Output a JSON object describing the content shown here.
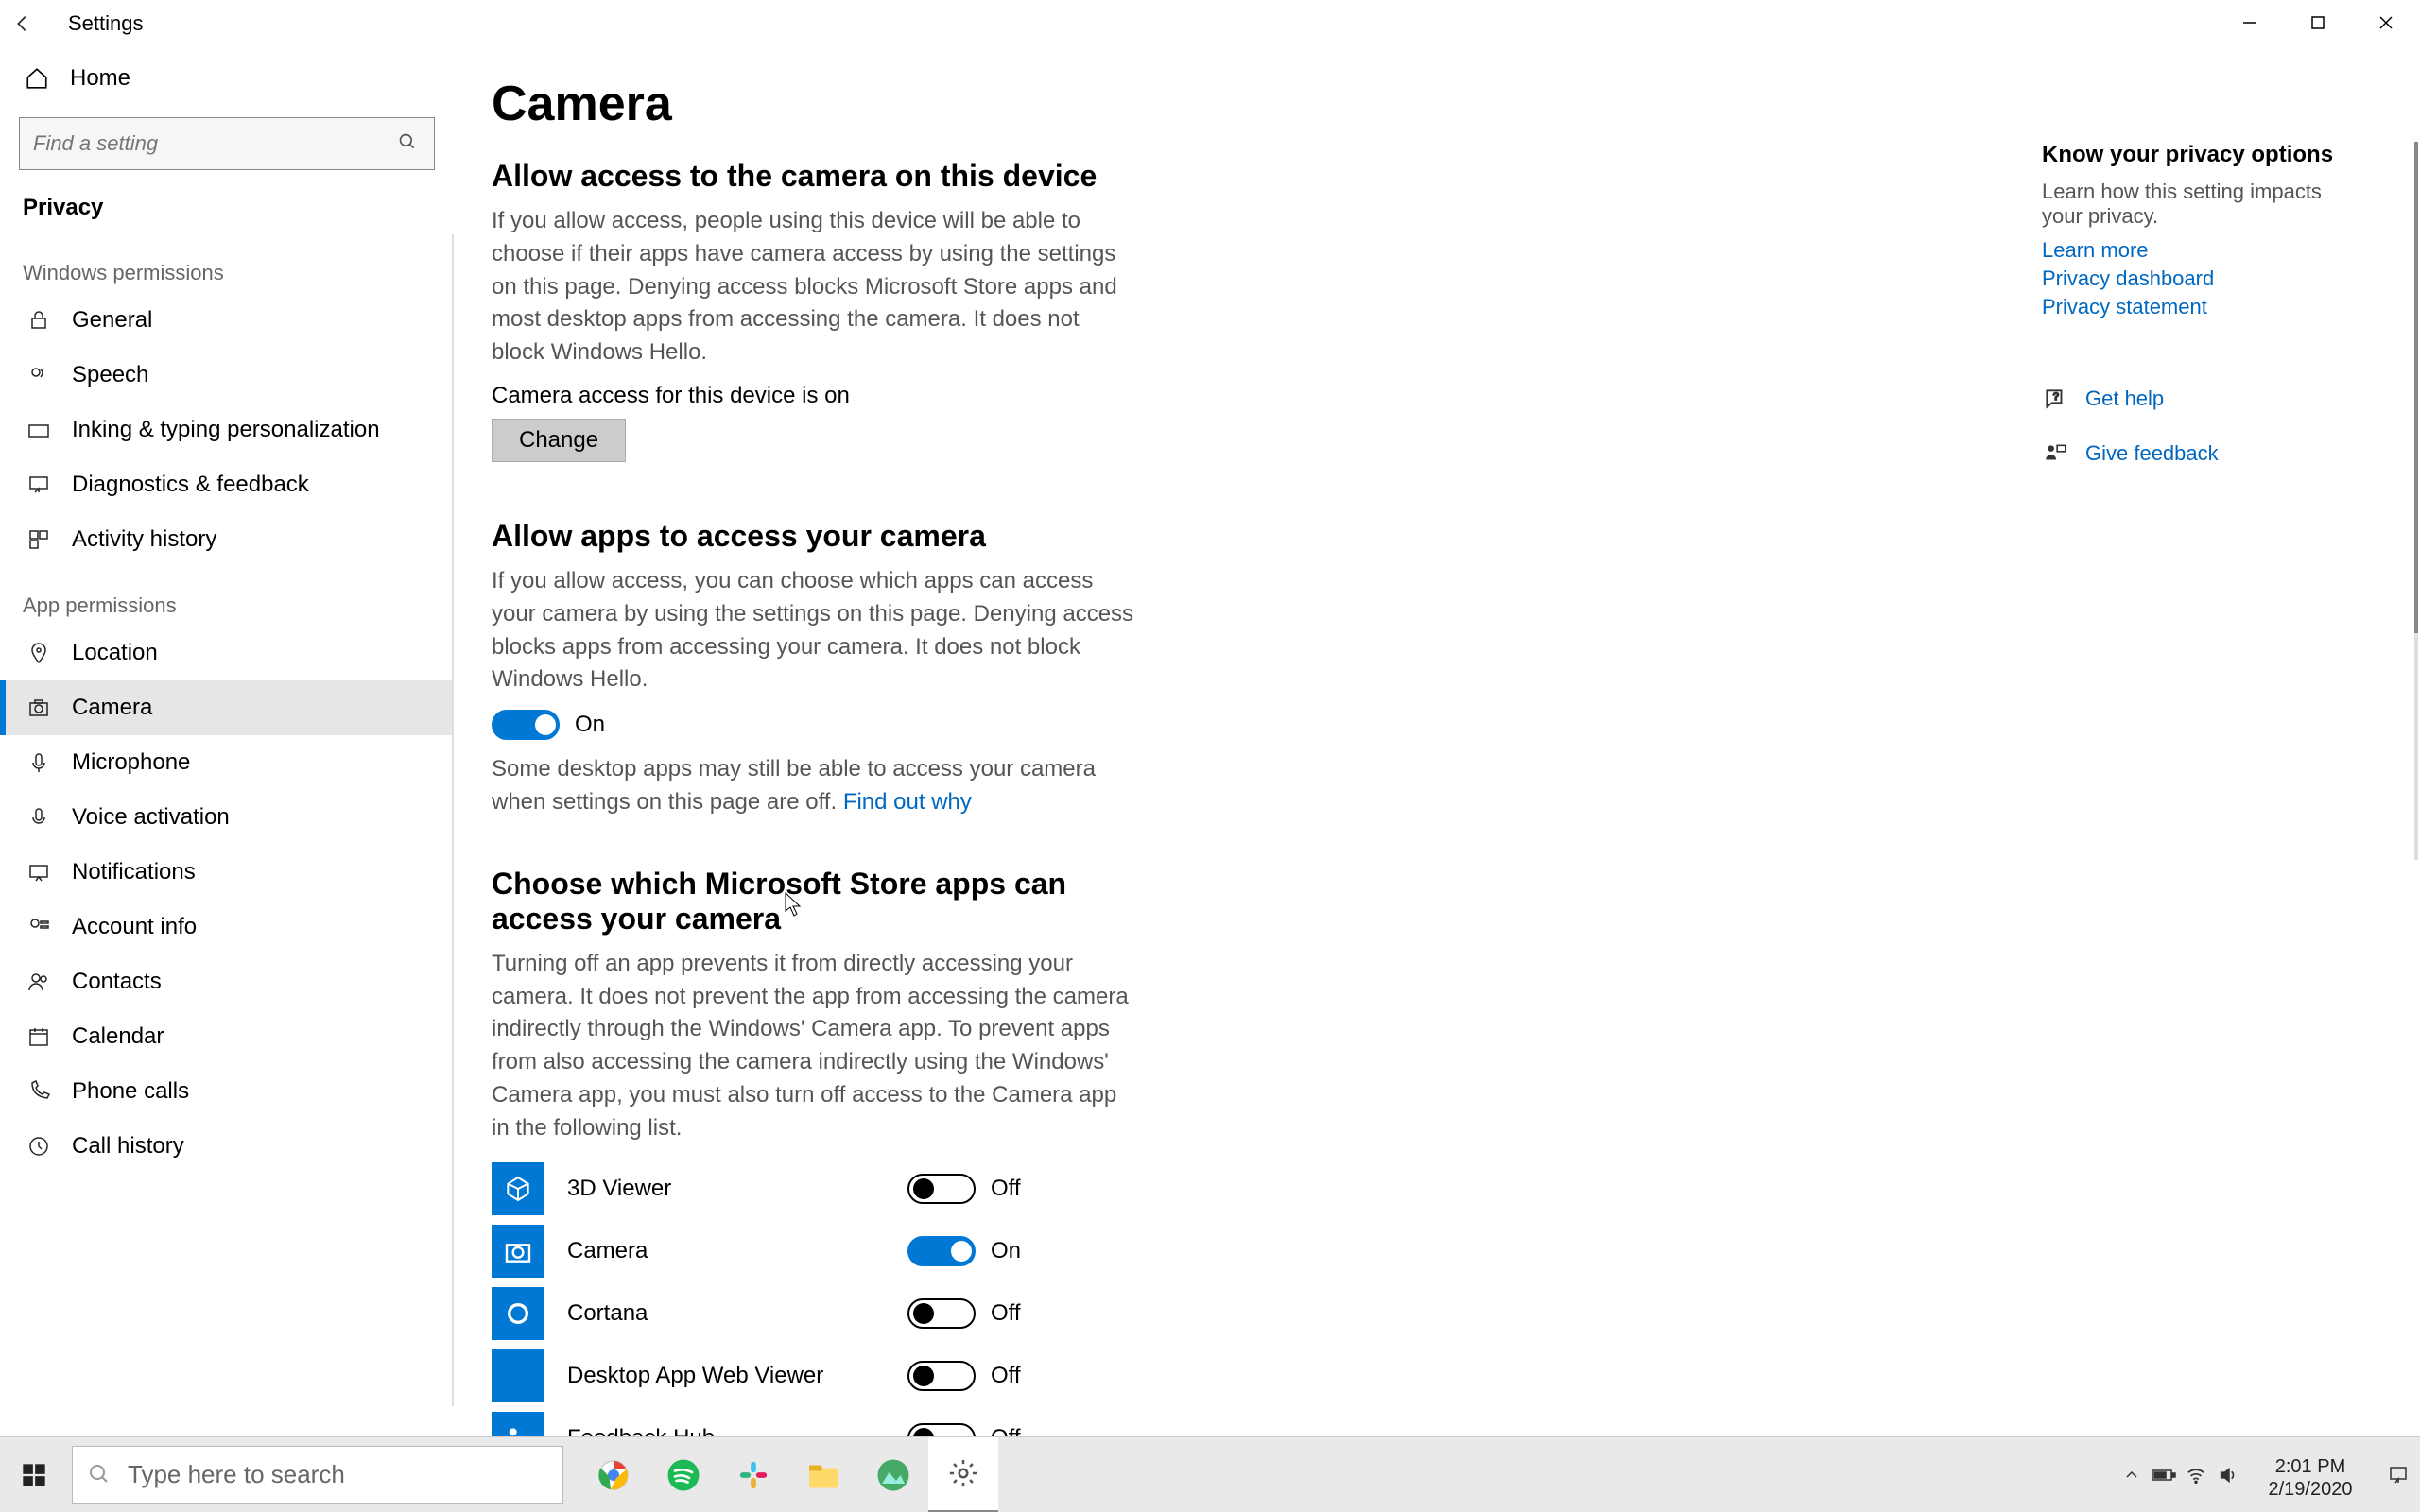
{
  "window": {
    "title": "Settings"
  },
  "sidebar": {
    "home": "Home",
    "search_placeholder": "Find a setting",
    "category": "Privacy",
    "group_windows": "Windows permissions",
    "group_app": "App permissions",
    "windows_items": [
      {
        "id": "general",
        "label": "General"
      },
      {
        "id": "speech",
        "label": "Speech"
      },
      {
        "id": "inking",
        "label": "Inking & typing personalization"
      },
      {
        "id": "diagnostics",
        "label": "Diagnostics & feedback"
      },
      {
        "id": "activity",
        "label": "Activity history"
      }
    ],
    "app_items": [
      {
        "id": "location",
        "label": "Location"
      },
      {
        "id": "camera",
        "label": "Camera",
        "selected": true
      },
      {
        "id": "microphone",
        "label": "Microphone"
      },
      {
        "id": "voice",
        "label": "Voice activation"
      },
      {
        "id": "notifications",
        "label": "Notifications"
      },
      {
        "id": "account",
        "label": "Account info"
      },
      {
        "id": "contacts",
        "label": "Contacts"
      },
      {
        "id": "calendar",
        "label": "Calendar"
      },
      {
        "id": "phone",
        "label": "Phone calls"
      },
      {
        "id": "callhistory",
        "label": "Call history"
      }
    ]
  },
  "main": {
    "page_title": "Camera",
    "section1_title": "Allow access to the camera on this device",
    "section1_body": "If you allow access, people using this device will be able to choose if their apps have camera access by using the settings on this page. Denying access blocks Microsoft Store apps and most desktop apps from accessing the camera. It does not block Windows Hello.",
    "device_status": "Camera access for this device is on",
    "change_btn": "Change",
    "section2_title": "Allow apps to access your camera",
    "section2_body": "If you allow access, you can choose which apps can access your camera by using the settings on this page. Denying access blocks apps from accessing your camera. It does not block Windows Hello.",
    "apps_toggle_state": "On",
    "desktop_note_pre": "Some desktop apps may still be able to access your camera when settings on this page are off. ",
    "desktop_note_link": "Find out why",
    "section3_title": "Choose which Microsoft Store apps can access your camera",
    "section3_body": "Turning off an app prevents it from directly accessing your camera. It does not prevent the app from accessing the camera indirectly through the Windows' Camera app. To prevent apps from also accessing the camera indirectly using the Windows' Camera app, you must also turn off access to the Camera app in the following list.",
    "apps": [
      {
        "name": "3D Viewer",
        "state": "Off",
        "on": false
      },
      {
        "name": "Camera",
        "state": "On",
        "on": true
      },
      {
        "name": "Cortana",
        "state": "Off",
        "on": false
      },
      {
        "name": "Desktop App Web Viewer",
        "state": "Off",
        "on": false
      },
      {
        "name": "Feedback Hub",
        "state": "Off",
        "on": false
      }
    ]
  },
  "right": {
    "title": "Know your privacy options",
    "body": "Learn how this setting impacts your privacy.",
    "links": [
      "Learn more",
      "Privacy dashboard",
      "Privacy statement"
    ],
    "help": "Get help",
    "feedback": "Give feedback"
  },
  "taskbar": {
    "search_placeholder": "Type here to search",
    "time": "2:01 PM",
    "date": "2/19/2020"
  }
}
